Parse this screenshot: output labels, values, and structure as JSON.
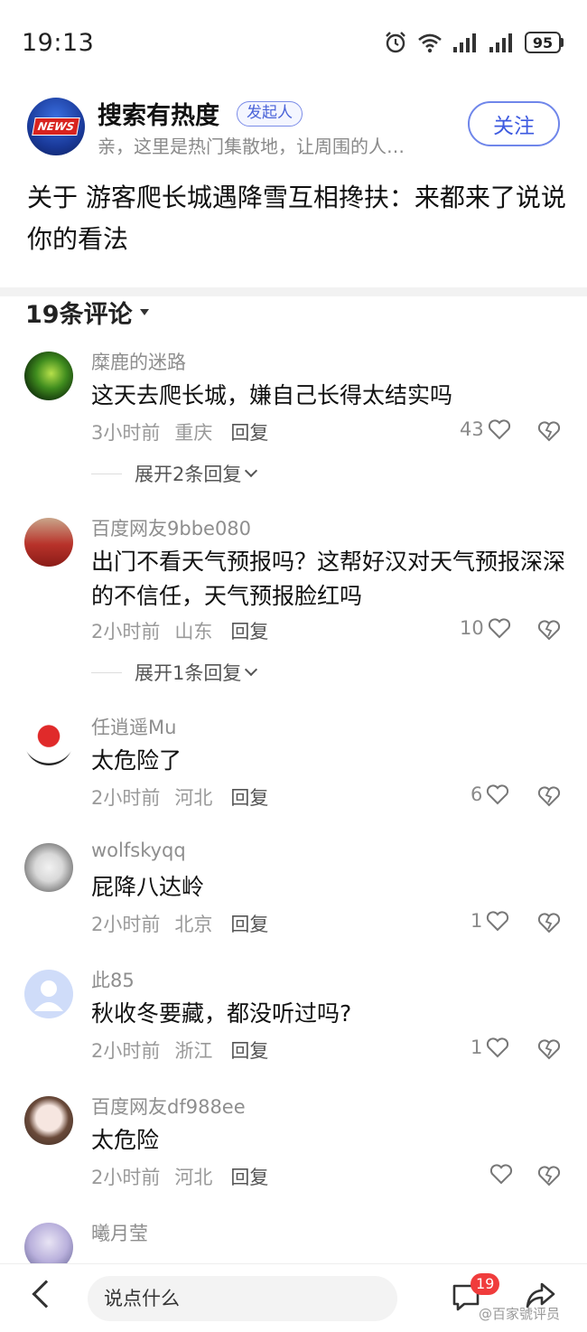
{
  "status": {
    "time": "19:13",
    "battery": "95"
  },
  "post": {
    "author": "搜索有热度",
    "badge": "发起人",
    "avatar_label": "NEWS",
    "description": "亲，这里是热门集散地，让周围的人…",
    "follow_label": "关注",
    "title_prefix": "关于 ",
    "title": "游客爬长城遇降雪互相搀扶：来都来了说说你的看法"
  },
  "comments_header": "19条评论",
  "comments": [
    {
      "user": "糜鹿的迷路",
      "text": "这天去爬长城，嫌自己长得太结实吗",
      "time": "3小时前",
      "location": "重庆",
      "reply": "回复",
      "likes": "43",
      "expand": "展开2条回复"
    },
    {
      "user": "百度网友9bbe080",
      "text": "出门不看天气预报吗？这帮好汉对天气预报深深的不信任，天气预报脸红吗",
      "time": "2小时前",
      "location": "山东",
      "reply": "回复",
      "likes": "10",
      "expand": "展开1条回复"
    },
    {
      "user": "任逍遥Mu",
      "text": "太危险了",
      "time": "2小时前",
      "location": "河北",
      "reply": "回复",
      "likes": "6"
    },
    {
      "user": "wolfskyqq",
      "text": "屁降八达岭",
      "time": "2小时前",
      "location": "北京",
      "reply": "回复",
      "likes": "1"
    },
    {
      "user": "此85",
      "text": "秋收冬要藏，都没听过吗?",
      "time": "2小时前",
      "location": "浙江",
      "reply": "回复",
      "likes": "1"
    },
    {
      "user": "百度网友df988ee",
      "text": "太危险",
      "time": "2小时前",
      "location": "河北",
      "reply": "回复",
      "likes": ""
    },
    {
      "user": "曦月莹",
      "text": ""
    }
  ],
  "bottom_bar": {
    "input_placeholder": "说点什么",
    "comment_count": "19",
    "watermark": "@百家號评员"
  },
  "colors": {
    "accent": "#3d5ae0",
    "badge_red": "#f03c3c"
  }
}
